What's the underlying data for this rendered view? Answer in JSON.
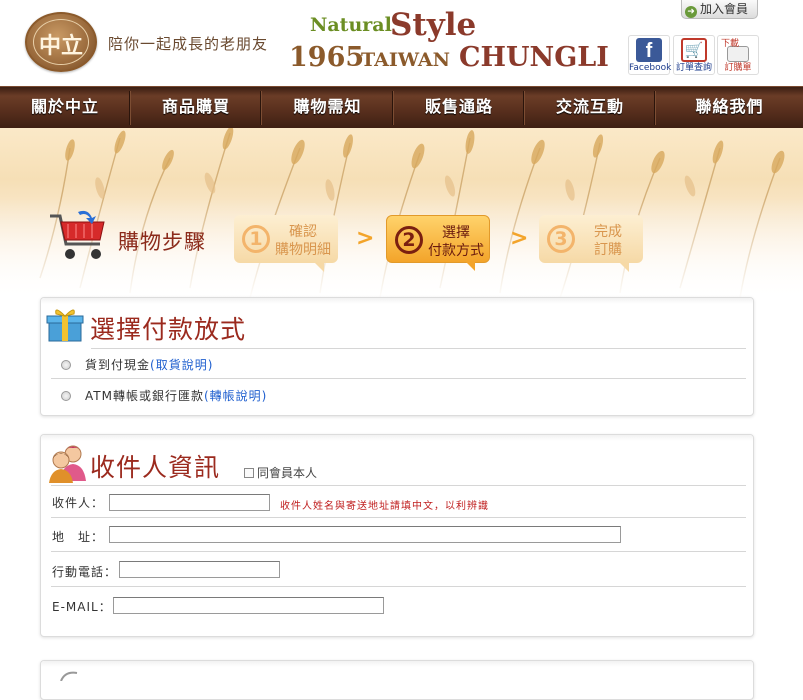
{
  "header": {
    "logo_mark": "中立",
    "slogan": "陪你一起成長的老朋友",
    "brand": {
      "natural": "Natural",
      "style": "Style",
      "year": "1965",
      "taiwan": "TAIWAN",
      "chungli": "CHUNGLI"
    },
    "join_label": "加入會員",
    "icons": {
      "facebook_glyph": "f",
      "facebook_label": "Facebook",
      "order_query_label": "訂單查詢",
      "download_top": "下載",
      "order_form_label": "訂購單"
    }
  },
  "nav": {
    "items": [
      "關於中立",
      "商品購買",
      "購物需知",
      "販售通路",
      "交流互動",
      "聯絡我們"
    ]
  },
  "steps": {
    "label": "購物步驟",
    "items": [
      {
        "num": "1",
        "line1": "確認",
        "line2": "購物明細",
        "active": false
      },
      {
        "num": "2",
        "line1": "選擇",
        "line2": "付款方式",
        "active": true
      },
      {
        "num": "3",
        "line1": "完成",
        "line2": "訂購",
        "active": false
      }
    ]
  },
  "payment": {
    "title": "選擇付款放式",
    "options": [
      {
        "label": "貨到付現金",
        "link": "(取貨說明)"
      },
      {
        "label": "ATM轉帳或銀行匯款",
        "link": "(轉帳說明)"
      }
    ]
  },
  "recipient": {
    "title": "收件人資訊",
    "same_member_label": "同會員本人",
    "fields": {
      "name_label": "收件人：",
      "address_label": "地　址：",
      "mobile_label": "行動電話：",
      "email_label": "E-MAIL："
    },
    "note": "收件人姓名與寄送地址請填中文，以利辨識"
  },
  "colors": {
    "accent": "#9b2a1e",
    "nav_bg": "#5a301e",
    "step_active": "#f3a42a",
    "link": "#1f5fcf"
  }
}
